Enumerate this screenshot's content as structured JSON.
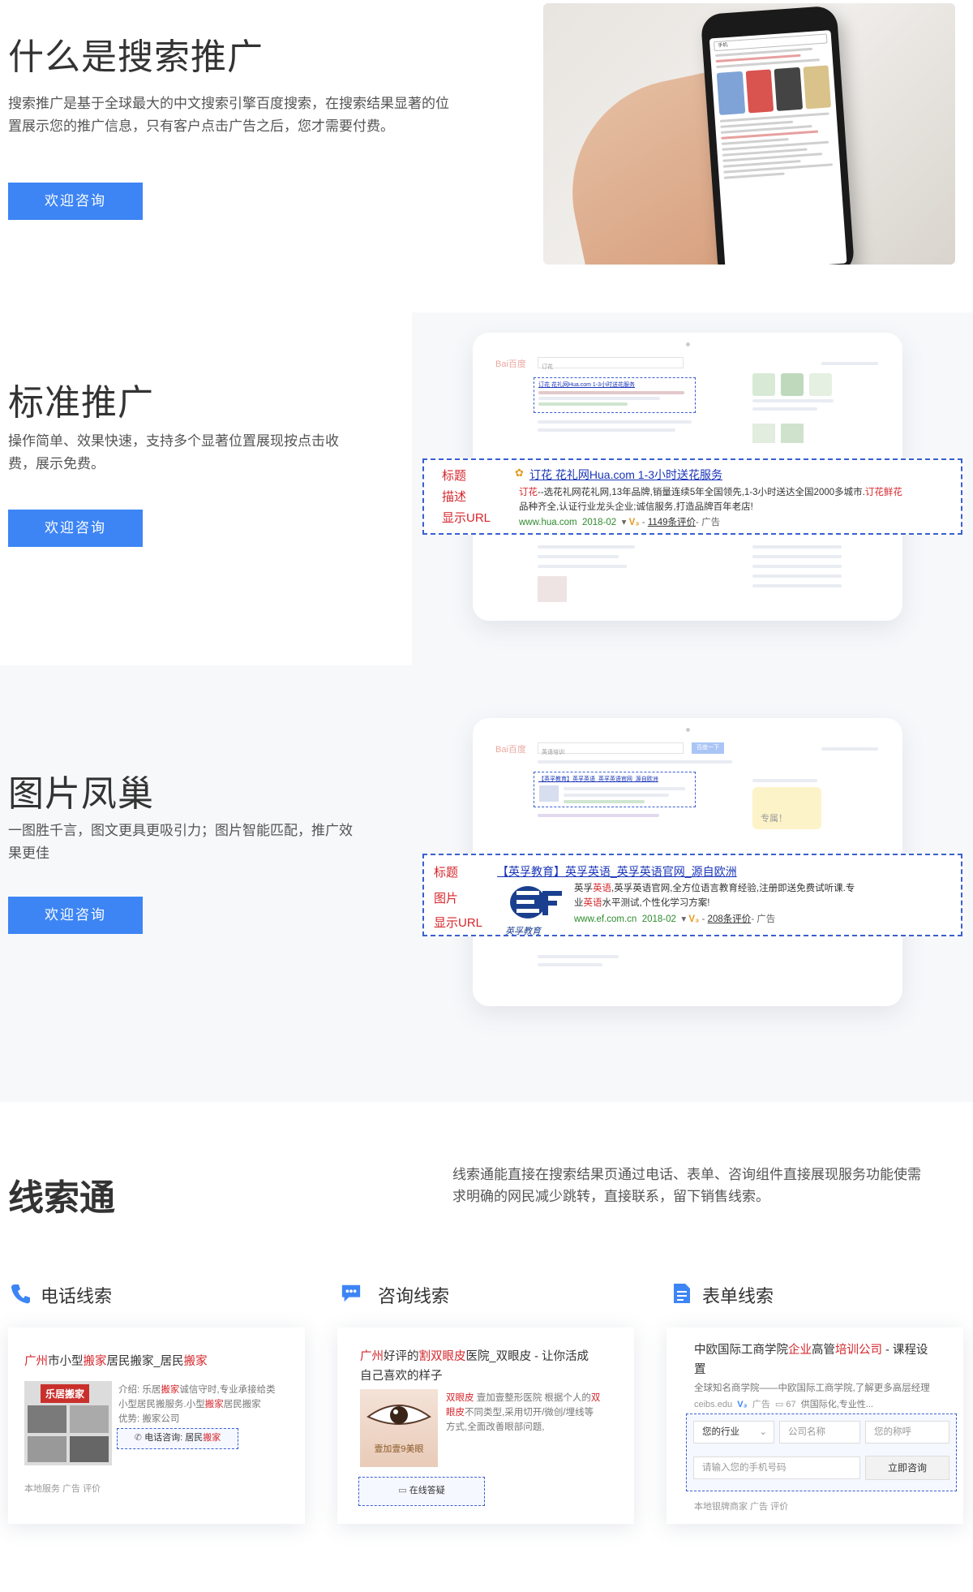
{
  "intro": {
    "title": "什么是搜索推广",
    "desc_line1": "搜索推广是基于全球最大的中文搜索引擎百度搜索，在搜索结果显著的位",
    "desc_line2": "置展示您的推广信息，只有客户点击广告之后，您才需要付费。",
    "button": "欢迎咨询",
    "phone_search": "手机"
  },
  "standard": {
    "title": "标准推广",
    "desc_line1": "操作简单、效果快速，支持多个显著位置展现按点击收",
    "desc_line2": "费，展示免费。",
    "button": "欢迎咨询",
    "mock_logo": "Bai百度",
    "mock_query": "订花",
    "callout": {
      "label_title": "标题",
      "label_desc": "描述",
      "label_url": "显示URL",
      "ad_title": "订花 花礼网Hua.com 1-3小时送花服务",
      "desc_red1": "订花",
      "desc_part1": "--选花礼网花礼网,13年品牌,销量连续5年全国领先,1-3小时送达全国2000多城市.",
      "desc_red2": "订花鲜花",
      "desc_part2": "品种齐全,认证行业龙头企业;诚信服务,打造品牌百年老店!",
      "url": "www.hua.com",
      "date": "2018-02",
      "reviews": "1149条评价",
      "ad_tag": "- 广告"
    }
  },
  "image": {
    "title": "图片凤巢",
    "desc_line1": "一图胜千言，图文更具更吸引力；图片智能匹配，推广效",
    "desc_line2": "果更佳",
    "button": "欢迎咨询",
    "mock_logo": "Bai百度",
    "mock_query": "英语培训",
    "mock_side_text": "专属！",
    "callout": {
      "label_title": "标题",
      "label_image": "图片",
      "label_url": "显示URL",
      "ad_title": "【英孚教育】英孚英语_英孚英语官网_源自欧洲",
      "desc_part1": "英孚",
      "desc_red1": "英语",
      "desc_part2": ",英孚英语官网,全方位语言教育经验,注册即送免费试听课.专",
      "desc_part3": "业",
      "desc_red2": "英语",
      "desc_part4": "水平测试,个性化学习方案!",
      "url": "www.ef.com.cn",
      "date": "2018-02",
      "reviews": "208条评价",
      "ad_tag": "- 广告",
      "logo_text": "英孚教育"
    }
  },
  "leads": {
    "title": "线索通",
    "desc_line1": "线索通能直接在搜索结果页通过电话、表单、咨询组件直接展现服务功能使需",
    "desc_line2": "求明确的网民减少跳转，直接联系，留下销售线索。",
    "phone": {
      "heading": "电话线索",
      "title_red1": "广州",
      "title_part1": "市小型",
      "title_red2": "搬家",
      "title_part2": "居民搬家_居民",
      "title_red3": "搬家",
      "thumb_text": "乐居搬家",
      "text1_a": "介绍: 乐居",
      "text1_red": "搬家",
      "text1_b": "诚信守时,专业承接给类",
      "text2": "小型居民搬服务.小型",
      "text2_red": "搬家",
      "text2_b": "居民搬家",
      "text3": "优势: 搬家公司",
      "call_button_a": "电话咨询: 居民",
      "call_button_red": "搬家",
      "meta": "本地服务   广告   评价"
    },
    "consult": {
      "heading": "咨询线索",
      "title_red1": "广州",
      "title_part1": "好评的",
      "title_red2": "割双眼皮",
      "title_part2": "医院_双眼皮 - 让你活成",
      "title_line2": "自己喜欢的样子",
      "text1_red": "双眼皮",
      "text1_b": " 壹加壹整形医院 根据个人的",
      "text1_red2": "双",
      "text2_red": "眼皮",
      "text2_b": "不同类型,采用切开/微创/埋线等",
      "text3": "方式,全面改善眼部问题,",
      "thumb_text": "壹加壹9美眼",
      "button": "在线答疑"
    },
    "form": {
      "heading": "表单线索",
      "title_part1": "中欧国际工商学院",
      "title_red1": "企业",
      "title_part2": "高管",
      "title_red2": "培训公司",
      "title_part3": " - 课程设",
      "title_line2": "置",
      "text1": "全球知名商学院——中欧国际工商学院,了解更多高层经理",
      "meta1": "ceibs.edu",
      "meta2": "广告",
      "meta3": "67",
      "meta4": "供国际化,专业性...",
      "field_industry": "您的行业",
      "field_company": "公司名称",
      "field_name": "您的称呼",
      "field_phone": "请输入您的手机号码",
      "submit": "立即咨询",
      "meta": "本地银牌商家   广告   评价"
    }
  },
  "colors": {
    "button_blue": "#3d85f5",
    "highlight_red": "#d5262c",
    "link_blue": "#1a35b8",
    "url_green": "#2e8b2e",
    "dashed_border": "#3b5fd1"
  }
}
